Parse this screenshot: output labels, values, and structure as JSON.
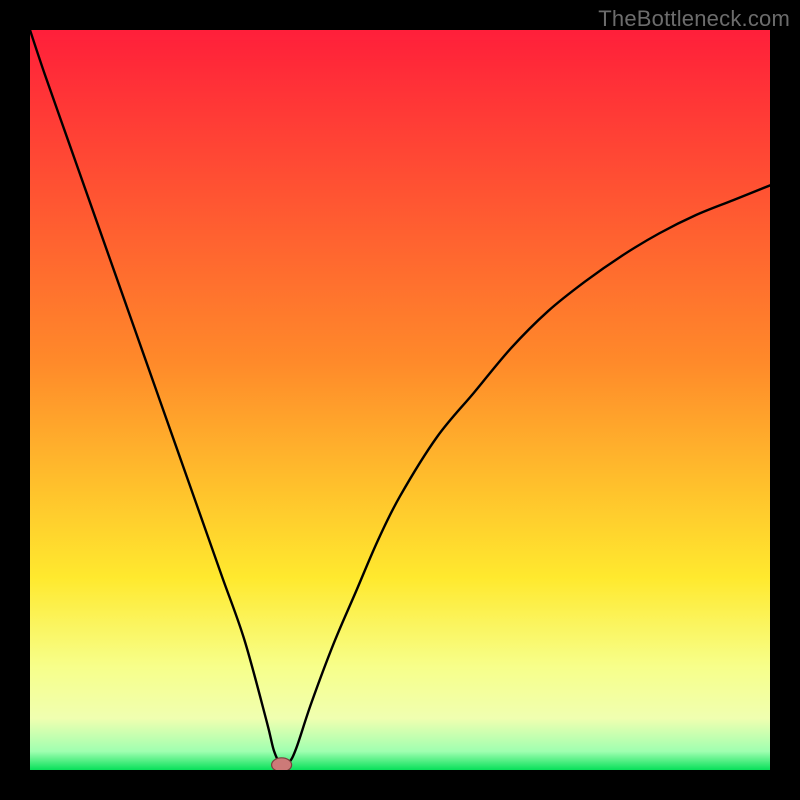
{
  "attribution": "TheBottleneck.com",
  "colors": {
    "gradient_top": "#ff1f3a",
    "gradient_mid1": "#ff8a2a",
    "gradient_mid2": "#ffe92e",
    "gradient_band_light": "#f7ff8a",
    "gradient_green": "#08e05a",
    "curve": "#000000",
    "marker_fill": "#cc7a78",
    "marker_stroke": "#7a3f3e",
    "frame": "#000000"
  },
  "chart_data": {
    "type": "line",
    "title": "",
    "xlabel": "",
    "ylabel": "",
    "xlim": [
      0,
      100
    ],
    "ylim": [
      0,
      100
    ],
    "grid": false,
    "legend": false,
    "series": [
      {
        "name": "bottleneck-curve",
        "x": [
          0,
          2,
          5,
          8,
          11,
          14,
          17,
          20,
          23,
          26,
          29,
          32,
          33,
          34,
          35,
          36,
          38,
          41,
          44,
          47,
          50,
          55,
          60,
          65,
          70,
          75,
          80,
          85,
          90,
          95,
          100
        ],
        "y": [
          100,
          94,
          85.5,
          77,
          68.5,
          60,
          51.5,
          43,
          34.5,
          26,
          17.5,
          6.5,
          2.5,
          0.7,
          1,
          3,
          9,
          17,
          24,
          31,
          37,
          45,
          51,
          57,
          62,
          66,
          69.5,
          72.5,
          75,
          77,
          79
        ]
      }
    ],
    "annotations": [
      {
        "name": "optimal-marker",
        "x": 34,
        "y": 0.7,
        "shape": "ellipse"
      }
    ]
  }
}
